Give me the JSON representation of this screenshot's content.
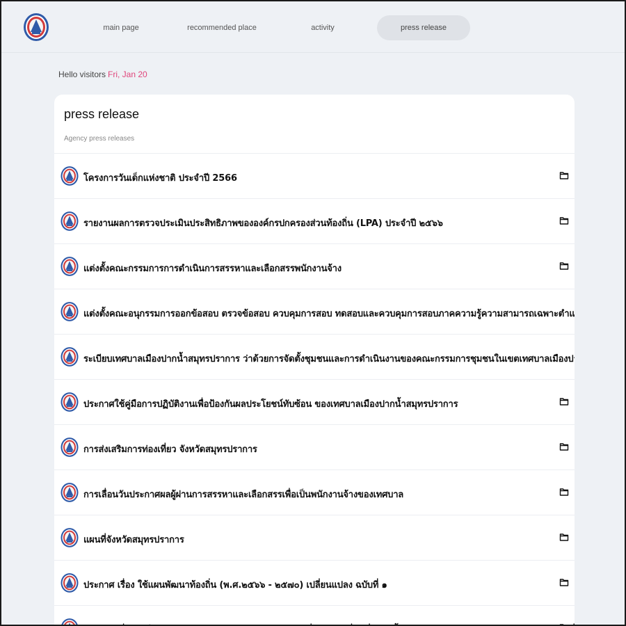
{
  "nav": {
    "items": [
      {
        "label": "main page"
      },
      {
        "label": "recommended place"
      },
      {
        "label": "activity"
      },
      {
        "label": "press release",
        "active": true
      }
    ]
  },
  "greeting": {
    "text": "Hello visitors",
    "date": "Fri, Jan 20"
  },
  "card": {
    "title": "press release",
    "subtitle": "Agency press releases",
    "items": [
      {
        "title": "โครงการวันเด็กแห่งชาติ ประจำปี 2566",
        "icon": "folder-icon"
      },
      {
        "title": "รายงานผลการตรวจประเมินประสิทธิภาพขององค์กรปกครองส่วนท้องถิ่น (LPA) ประจำปี ๒๕๖๖",
        "icon": "folder-icon"
      },
      {
        "title": "แต่งตั้งคณะกรรมการการดำเนินการสรรหาและเลือกสรรพนักงานจ้าง",
        "icon": "folder-icon"
      },
      {
        "title": "แต่งตั้งคณะอนุกรรมการออกข้อสอบ ตรวจข้อสอบ ควบคุมการสอบ ทดสอบและควบคุมการสอบภาคความรู้ความสามารถเฉพาะตำแหน่งและสอบสั",
        "icon": ""
      },
      {
        "title": "ระเบียบเทศบาลเมืองปากน้ำสมุทรปราการ ว่าด้วยการจัดตั้งชุมชนและการดำเนินงานของคณะกรรมการชุมชนในเขตเทศบาลเมืองปากน้ำสมุทรปราก",
        "icon": ""
      },
      {
        "title": "ประกาศใช้คู่มือการปฏิบัติงานเพื่อป้องกันผลประโยชน์ทับซ้อน  ของเทศบาลเมืองปากน้ำสมุทรปราการ",
        "icon": "folder-icon"
      },
      {
        "title": "การส่งเสริมการท่องเที่ยว จังหวัดสมุทรปราการ",
        "icon": "folder-icon"
      },
      {
        "title": "การเลื่อนวันประกาศผลผู้ผ่านการสรรหาและเลือกสรรเพื่อเป็นพนักงานจ้างของเทศบาล",
        "icon": "folder-icon"
      },
      {
        "title": "แผนที่จังหวัดสมุทรปราการ",
        "icon": "folder-icon"
      },
      {
        "title": "ประกาศ เรื่อง ใช้แผนพัฒนาท้องถิ่น (พ.ศ.๒๕๖๖ - ๒๕๗๐) เปลี่ยนแปลง ฉบับที่ ๑",
        "icon": "folder-icon"
      },
      {
        "title": "ประกาศ เรื่อง รับโอนพนักงานเทศบาลหรือพนักงานส่วนท้องถิ่นประเภทอื่น เพื่อแต่งตั้งให้ดำรงตำแหน่งสายงาน ผู้ปฏิบัติในตำแหน่งที่ว่าง",
        "icon": "folder-icon"
      }
    ]
  },
  "colors": {
    "date_accent": "#e0457b",
    "logo_blue": "#2f5aa8",
    "logo_red": "#d23b3b"
  }
}
